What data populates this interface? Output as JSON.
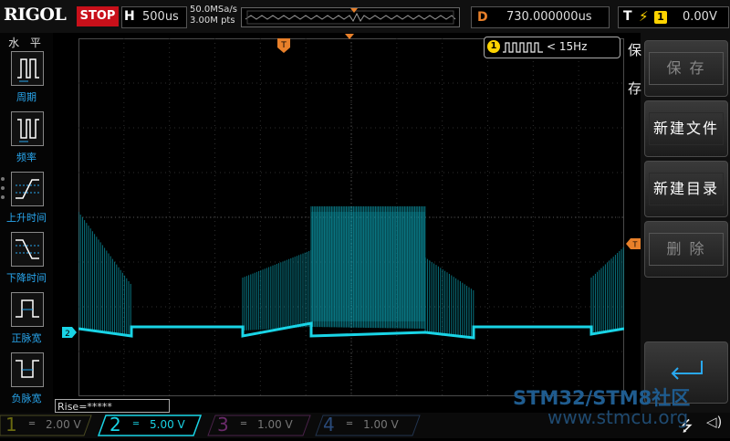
{
  "top": {
    "brand": "RIGOL",
    "run_state": "STOP",
    "horizontal": {
      "label": "H",
      "value": "500us"
    },
    "sample_rate": "50.0MSa/s",
    "memory_depth": "3.00M pts",
    "delay": {
      "label": "D",
      "value": "730.000000us"
    },
    "trigger": {
      "label": "T",
      "source": "1",
      "level": "0.00V"
    }
  },
  "left_menu": {
    "title": "水 平",
    "items": [
      {
        "label": "周期",
        "icon": "period-icon"
      },
      {
        "label": "频率",
        "icon": "frequency-icon"
      },
      {
        "label": "上升时间",
        "icon": "rise-time-icon"
      },
      {
        "label": "下降时间",
        "icon": "fall-time-icon"
      },
      {
        "label": "正脉宽",
        "icon": "positive-width-icon"
      },
      {
        "label": "负脉宽",
        "icon": "negative-width-icon"
      }
    ]
  },
  "measure": {
    "ch1_freq": "< 15Hz",
    "ch1_badge": "1",
    "rise": "Rise=*****"
  },
  "markers": {
    "ch2": "2",
    "trigger_pos": "T",
    "trigger_level": "T"
  },
  "right_menu": {
    "title": "保 存",
    "buttons": [
      {
        "label": "保 存",
        "enabled": false
      },
      {
        "label": "新建文件",
        "enabled": true
      },
      {
        "label": "新建目录",
        "enabled": true
      },
      {
        "label": "删 除",
        "enabled": false
      }
    ],
    "return_icon": "return-icon"
  },
  "channels": [
    {
      "num": "1",
      "value": "2.00 V",
      "color": "#5a5a00",
      "active": false
    },
    {
      "num": "2",
      "value": "5.00 V",
      "color": "#19d4e6",
      "active": true
    },
    {
      "num": "3",
      "value": "1.00 V",
      "color": "#5a2a5a",
      "active": false
    },
    {
      "num": "4",
      "value": "1.00 V",
      "color": "#2a4a7a",
      "active": false
    }
  ],
  "watermark": {
    "line1": "STM32/STM8社区",
    "line2": "www.stmcu.org"
  },
  "colors": {
    "ch2_trace": "#19d4e6",
    "ch2_fill": "#0c8a98",
    "trigger": "#e8802a",
    "ch1": "#ffd400",
    "grid": "#3a3a3a"
  }
}
